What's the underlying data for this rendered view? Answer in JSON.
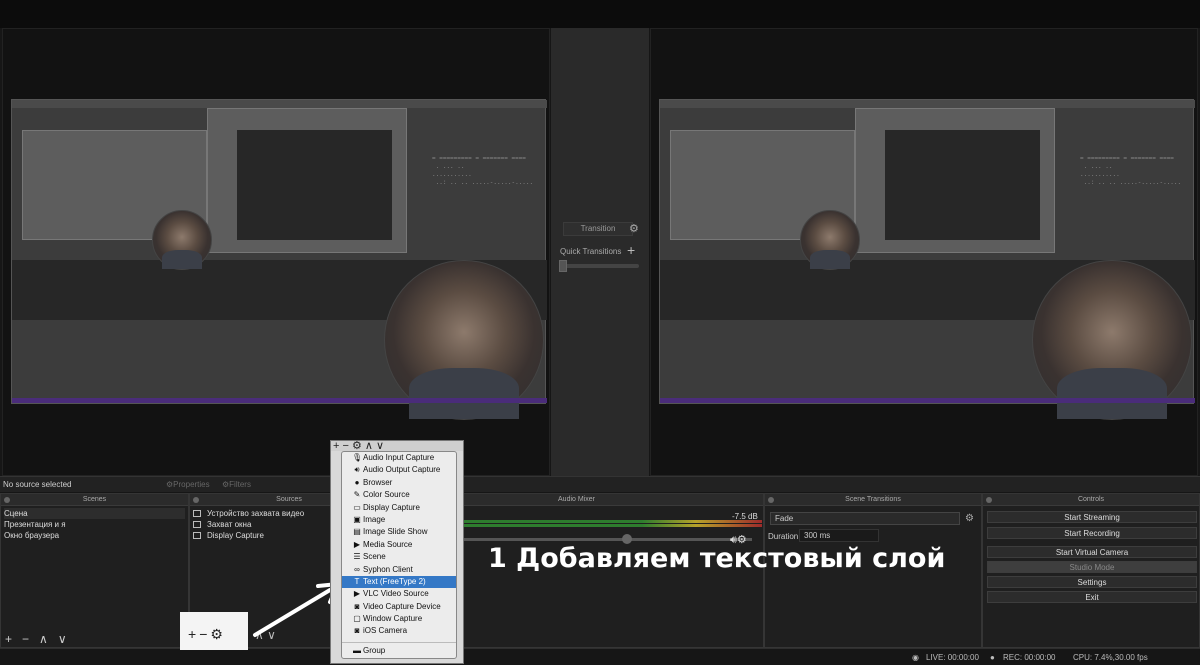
{
  "preview": {
    "transition_label": "Transition",
    "quick_transitions_label": "Quick Transitions"
  },
  "status_bar": {
    "no_source": "No source selected",
    "properties": "Properties",
    "filters": "Filters"
  },
  "docks": {
    "scenes": {
      "title": "Scenes",
      "items": [
        "Сцена",
        "Презентация и я",
        "Окно браузера"
      ]
    },
    "sources": {
      "title": "Sources",
      "items": [
        "Устройство захвата видео",
        "Захват окна",
        "Display Capture"
      ]
    },
    "audio_mixer": {
      "title": "Audio Mixer",
      "db_value": "-7.5 dB"
    },
    "scene_transitions": {
      "title": "Scene Transitions",
      "selected": "Fade",
      "duration_label": "Duration",
      "duration_value": "300 ms"
    },
    "controls": {
      "title": "Controls",
      "buttons": [
        "Start Streaming",
        "Start Recording",
        "Start Virtual Camera",
        "Studio Mode",
        "Settings",
        "Exit"
      ]
    }
  },
  "context_menu": {
    "items": [
      {
        "label": "Audio Input Capture",
        "icon": "microphone-icon"
      },
      {
        "label": "Audio Output Capture",
        "icon": "speaker-icon"
      },
      {
        "label": "Browser",
        "icon": "globe-icon"
      },
      {
        "label": "Color Source",
        "icon": "brush-icon"
      },
      {
        "label": "Display Capture",
        "icon": "monitor-icon"
      },
      {
        "label": "Image",
        "icon": "image-icon"
      },
      {
        "label": "Image Slide Show",
        "icon": "slideshow-icon"
      },
      {
        "label": "Media Source",
        "icon": "play-icon"
      },
      {
        "label": "Scene",
        "icon": "list-icon"
      },
      {
        "label": "Syphon Client",
        "icon": "infinity-icon"
      },
      {
        "label": "Text (FreeType 2)",
        "icon": "text-icon",
        "highlighted": true
      },
      {
        "label": "VLC Video Source",
        "icon": "play-icon"
      },
      {
        "label": "Video Capture Device",
        "icon": "camera-icon"
      },
      {
        "label": "Window Capture",
        "icon": "window-icon"
      },
      {
        "label": "iOS Camera",
        "icon": "camera-icon"
      },
      {
        "label": "Group",
        "icon": "folder-icon"
      }
    ]
  },
  "bottom_bar": {
    "live": "LIVE: 00:00:00",
    "rec": "REC: 00:00:00",
    "cpu": "CPU: 7.4%,30.00 fps"
  },
  "annotation": {
    "text": "1 Добавляем  текстовый слой"
  },
  "colors": {
    "menu_highlight": "#3478c6",
    "annotation_text": "#ffffff"
  }
}
